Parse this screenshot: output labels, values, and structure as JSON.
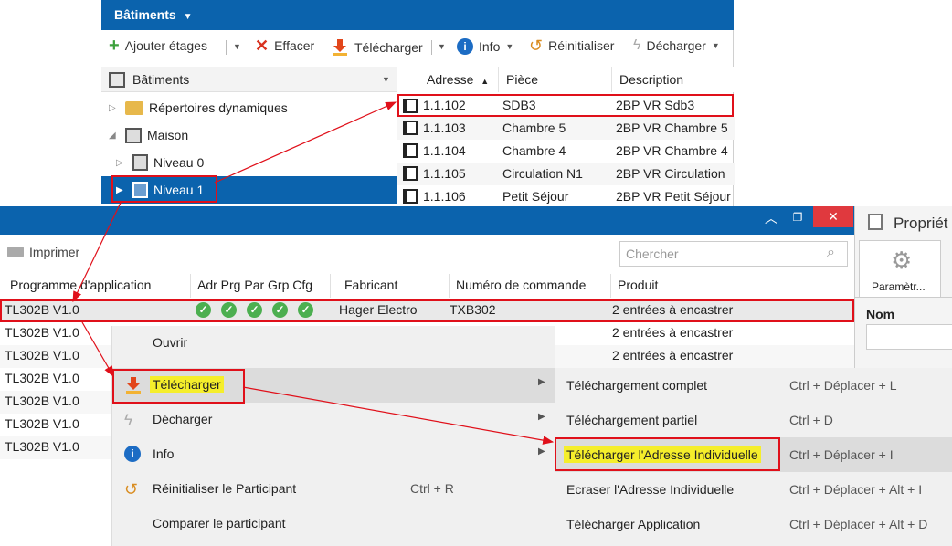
{
  "top_panel": {
    "title": "Bâtiments",
    "toolbar": {
      "add_floors": "Ajouter étages",
      "delete": "Effacer",
      "download": "Télécharger",
      "info": "Info",
      "reset": "Réinitialiser",
      "unload": "Décharger"
    },
    "tree": {
      "header": "Bâtiments",
      "items": [
        {
          "label": "Répertoires dynamiques"
        },
        {
          "label": "Maison"
        },
        {
          "label": "Niveau 0"
        },
        {
          "label": "Niveau 1"
        }
      ]
    },
    "grid": {
      "columns": [
        "Adresse",
        "Pièce",
        "Description"
      ],
      "rows": [
        {
          "address": "1.1.102",
          "room": "SDB3",
          "description": "2BP VR Sdb3"
        },
        {
          "address": "1.1.103",
          "room": "Chambre 5",
          "description": "2BP VR Chambre 5"
        },
        {
          "address": "1.1.104",
          "room": "Chambre 4",
          "description": "2BP VR Chambre 4"
        },
        {
          "address": "1.1.105",
          "room": "Circulation N1",
          "description": "2BP VR Circulation"
        },
        {
          "address": "1.1.106",
          "room": "Petit Séjour",
          "description": "2BP VR Petit Séjour"
        }
      ]
    }
  },
  "window": {
    "print_label": "Imprimer",
    "search_placeholder": "Chercher",
    "columns": [
      "Programme d'application",
      "Adr Prg Par Grp Cfg",
      "Fabricant",
      "Numéro de commande",
      "Produit"
    ],
    "rows": [
      {
        "program": "TL302B V1.0",
        "manufacturer": "Hager Electro",
        "order_number": "TXB302",
        "product": "2 entrées à encastrer"
      },
      {
        "program": "TL302B V1.0",
        "product": "2 entrées à encastrer"
      },
      {
        "program": "TL302B V1.0",
        "product": "2 entrées à encastrer"
      },
      {
        "program": "TL302B V1.0"
      },
      {
        "program": "TL302B V1.0"
      },
      {
        "program": "TL302B V1.0"
      },
      {
        "program": "TL302B V1.0"
      }
    ]
  },
  "side_panel": {
    "title": "Propriét",
    "tab": "Paramètr...",
    "name_label": "Nom"
  },
  "context_menu": {
    "items": [
      {
        "label": "Ouvrir"
      },
      {
        "label": "Télécharger"
      },
      {
        "label": "Décharger"
      },
      {
        "label": "Info"
      },
      {
        "label": "Réinitialiser le Participant",
        "shortcut": "Ctrl + R"
      },
      {
        "label": "Comparer le participant"
      }
    ]
  },
  "submenu": {
    "items": [
      {
        "label": "Téléchargement complet",
        "shortcut": "Ctrl + Déplacer + L"
      },
      {
        "label": "Téléchargement partiel",
        "shortcut": "Ctrl + D"
      },
      {
        "label": "Télécharger l'Adresse Individuelle",
        "shortcut": "Ctrl + Déplacer + I"
      },
      {
        "label": "Ecraser l'Adresse Individuelle",
        "shortcut": "Ctrl + Déplacer + Alt + I"
      },
      {
        "label": "Télécharger Application",
        "shortcut": "Ctrl + Déplacer + Alt + D"
      }
    ]
  },
  "colors": {
    "title_bar": "#0b63ad",
    "highlight": "#f5ee2b",
    "annotation": "#e0101a",
    "check": "#4caf50"
  }
}
